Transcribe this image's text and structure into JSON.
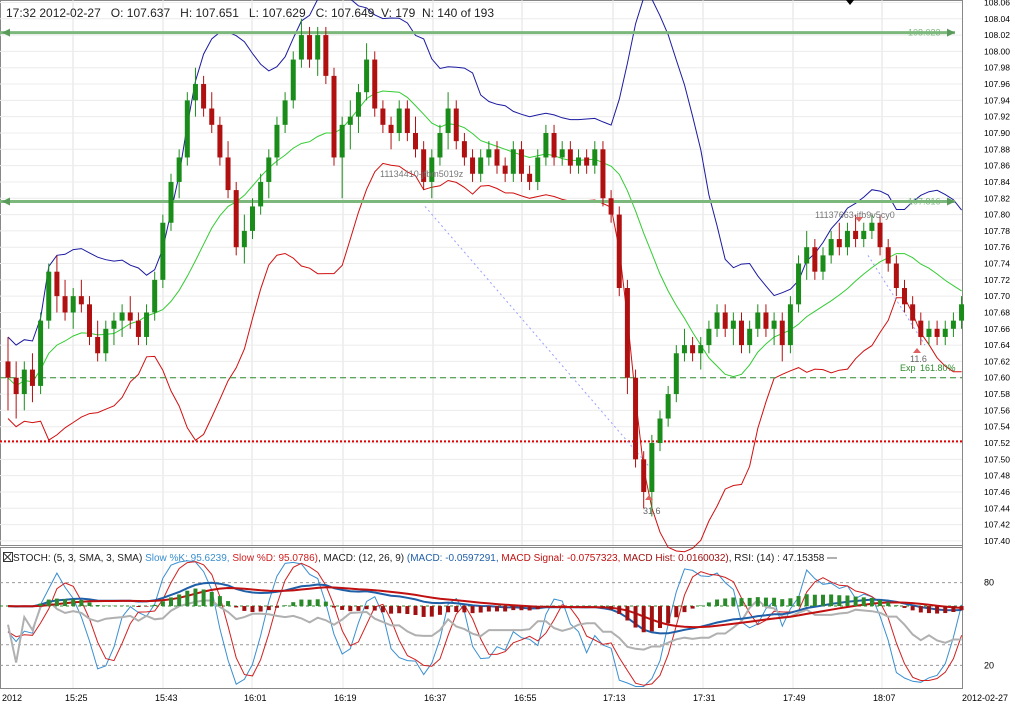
{
  "header": {
    "time": "17:32 2012-02-27",
    "open": "O: 107.637",
    "high": "H: 107.651",
    "low": "L: 107.629",
    "close": "C: 107.649",
    "volume": "V: 179",
    "bar_index": "N: 140 of 193"
  },
  "indicators": {
    "stoch_label": "STOCH: (5, 3, SMA, 3, SMA)",
    "slow_k": "Slow %K: 95.6239,",
    "slow_d": "Slow %D: 95.0786)",
    "macd_label": ", MACD: (12, 26, 9)",
    "macd": "(MACD: -0.0597291,",
    "macd_signal": "MACD Signal: -0.0757323,",
    "macd_hist": "MACD Hist: 0.0160032)",
    "rsi": ", RSI: (14) : 47.15358",
    "colors": {
      "k": "#3a8fd0",
      "d": "#d02020",
      "macd": "#1f5fa8",
      "signal": "#c01010",
      "hist_pos": "#2a8a2a",
      "hist_neg": "#a01010",
      "rsi": "#b0b0b0"
    }
  },
  "price_axis": {
    "labels": [
      "108.06",
      "108.04",
      "108.02",
      "108.00",
      "107.98",
      "107.96",
      "107.94",
      "107.92",
      "107.90",
      "107.88",
      "107.86",
      "107.84",
      "107.82",
      "107.80",
      "107.78",
      "107.76",
      "107.74",
      "107.72",
      "107.70",
      "107.68",
      "107.66",
      "107.64",
      "107.62",
      "107.60",
      "107.58",
      "107.56",
      "107.54",
      "107.52",
      "107.50",
      "107.48",
      "107.46",
      "107.44",
      "107.42",
      "107.40"
    ],
    "ylim": [
      107.395,
      108.063
    ]
  },
  "time_axis": {
    "labels": [
      "2012",
      "15:25",
      "15:43",
      "16:01",
      "16:19",
      "16:37",
      "16:55",
      "17:13",
      "17:31",
      "17:49",
      "18:07",
      "2012-02-27"
    ]
  },
  "osc_axis": {
    "labels": [
      "80",
      "20"
    ]
  },
  "annotations": {
    "level_high": "108.023",
    "level_low": "107.816",
    "text_left": "11134410-jfbm5019z",
    "text_right": "11137663-jfb9v5cy0",
    "label_31": "31.6",
    "label_11": "11.6",
    "exp_label": "Exp",
    "exp_value": "161.80%"
  },
  "chart_data": {
    "type": "candlestick",
    "symbol_date": "2012-02-27",
    "price_range": [
      107.4,
      108.06
    ],
    "horizontal_levels": {
      "resistance": 108.023,
      "support": 107.816,
      "green_dashed": 107.6,
      "red_dotted": 107.522
    },
    "candles_ohlc": [
      [
        107.62,
        107.65,
        107.56,
        107.6
      ],
      [
        107.6,
        107.62,
        107.55,
        107.58
      ],
      [
        107.58,
        107.62,
        107.56,
        107.61
      ],
      [
        107.61,
        107.63,
        107.57,
        107.59
      ],
      [
        107.59,
        107.68,
        107.58,
        107.67
      ],
      [
        107.67,
        107.74,
        107.66,
        107.73
      ],
      [
        107.73,
        107.75,
        107.68,
        107.7
      ],
      [
        107.7,
        107.72,
        107.67,
        107.68
      ],
      [
        107.68,
        107.71,
        107.66,
        107.7
      ],
      [
        107.7,
        107.72,
        107.68,
        107.69
      ],
      [
        107.69,
        107.7,
        107.64,
        107.65
      ],
      [
        107.65,
        107.67,
        107.62,
        107.63
      ],
      [
        107.63,
        107.67,
        107.62,
        107.66
      ],
      [
        107.66,
        107.68,
        107.64,
        107.67
      ],
      [
        107.67,
        107.69,
        107.65,
        107.68
      ],
      [
        107.68,
        107.7,
        107.66,
        107.67
      ],
      [
        107.67,
        107.68,
        107.64,
        107.65
      ],
      [
        107.65,
        107.69,
        107.64,
        107.68
      ],
      [
        107.68,
        107.73,
        107.67,
        107.72
      ],
      [
        107.72,
        107.8,
        107.71,
        107.79
      ],
      [
        107.79,
        107.85,
        107.78,
        107.84
      ],
      [
        107.84,
        107.88,
        107.82,
        107.87
      ],
      [
        107.87,
        107.95,
        107.86,
        107.94
      ],
      [
        107.94,
        107.98,
        107.92,
        107.96
      ],
      [
        107.96,
        107.97,
        107.92,
        107.93
      ],
      [
        107.93,
        107.95,
        107.9,
        107.91
      ],
      [
        107.91,
        107.92,
        107.86,
        107.87
      ],
      [
        107.87,
        107.89,
        107.82,
        107.83
      ],
      [
        107.83,
        107.84,
        107.75,
        107.76
      ],
      [
        107.76,
        107.8,
        107.74,
        107.78
      ],
      [
        107.78,
        107.82,
        107.77,
        107.81
      ],
      [
        107.81,
        107.85,
        107.8,
        107.84
      ],
      [
        107.84,
        107.88,
        107.82,
        107.87
      ],
      [
        107.87,
        107.92,
        107.86,
        107.91
      ],
      [
        107.91,
        107.95,
        107.9,
        107.94
      ],
      [
        107.94,
        108.0,
        107.93,
        107.99
      ],
      [
        107.99,
        108.04,
        107.98,
        108.02
      ],
      [
        108.02,
        108.03,
        107.98,
        107.99
      ],
      [
        107.99,
        108.03,
        107.97,
        108.02
      ],
      [
        108.02,
        108.03,
        107.96,
        107.97
      ],
      [
        107.97,
        107.98,
        107.86,
        107.87
      ],
      [
        107.87,
        107.92,
        107.82,
        107.91
      ],
      [
        107.91,
        107.94,
        107.88,
        107.92
      ],
      [
        107.92,
        107.96,
        107.9,
        107.95
      ],
      [
        107.95,
        108.01,
        107.94,
        107.99
      ],
      [
        107.99,
        108.0,
        107.92,
        107.93
      ],
      [
        107.93,
        107.94,
        107.9,
        107.91
      ],
      [
        107.91,
        107.92,
        107.88,
        107.9
      ],
      [
        107.9,
        107.94,
        107.89,
        107.93
      ],
      [
        107.93,
        107.94,
        107.89,
        107.9
      ],
      [
        107.9,
        107.92,
        107.87,
        107.88
      ],
      [
        107.88,
        107.89,
        107.83,
        107.84
      ],
      [
        107.84,
        107.88,
        107.82,
        107.87
      ],
      [
        107.87,
        107.91,
        107.86,
        107.9
      ],
      [
        107.9,
        107.95,
        107.88,
        107.93
      ],
      [
        107.93,
        107.94,
        107.88,
        107.89
      ],
      [
        107.89,
        107.9,
        107.86,
        107.87
      ],
      [
        107.87,
        107.88,
        107.84,
        107.85
      ],
      [
        107.85,
        107.88,
        107.84,
        107.87
      ],
      [
        107.87,
        107.89,
        107.86,
        107.88
      ],
      [
        107.88,
        107.89,
        107.85,
        107.86
      ],
      [
        107.86,
        107.87,
        107.84,
        107.85
      ],
      [
        107.85,
        107.89,
        107.84,
        107.88
      ],
      [
        107.88,
        107.89,
        107.84,
        107.85
      ],
      [
        107.85,
        107.86,
        107.83,
        107.84
      ],
      [
        107.84,
        107.88,
        107.83,
        107.87
      ],
      [
        107.87,
        107.91,
        107.86,
        107.9
      ],
      [
        107.9,
        107.91,
        107.86,
        107.87
      ],
      [
        107.87,
        107.89,
        107.86,
        107.88
      ],
      [
        107.88,
        107.89,
        107.85,
        107.86
      ],
      [
        107.86,
        107.88,
        107.85,
        107.87
      ],
      [
        107.87,
        107.88,
        107.85,
        107.86
      ],
      [
        107.86,
        107.89,
        107.85,
        107.88
      ],
      [
        107.88,
        107.89,
        107.81,
        107.82
      ],
      [
        107.82,
        107.83,
        107.79,
        107.8
      ],
      [
        107.8,
        107.81,
        107.7,
        107.71
      ],
      [
        107.71,
        107.72,
        107.58,
        107.6
      ],
      [
        107.6,
        107.61,
        107.49,
        107.5
      ],
      [
        107.5,
        107.51,
        107.44,
        107.46
      ],
      [
        107.46,
        107.53,
        107.43,
        107.52
      ],
      [
        107.52,
        107.56,
        107.51,
        107.55
      ],
      [
        107.55,
        107.59,
        107.54,
        107.58
      ],
      [
        107.58,
        107.64,
        107.57,
        107.63
      ],
      [
        107.63,
        107.66,
        107.62,
        107.64
      ],
      [
        107.64,
        107.65,
        107.62,
        107.63
      ],
      [
        107.63,
        107.65,
        107.61,
        107.64
      ],
      [
        107.64,
        107.67,
        107.63,
        107.66
      ],
      [
        107.66,
        107.69,
        107.65,
        107.68
      ],
      [
        107.68,
        107.69,
        107.65,
        107.66
      ],
      [
        107.66,
        107.68,
        107.64,
        107.67
      ],
      [
        107.67,
        107.68,
        107.63,
        107.64
      ],
      [
        107.64,
        107.67,
        107.63,
        107.66
      ],
      [
        107.66,
        107.69,
        107.65,
        107.68
      ],
      [
        107.68,
        107.69,
        107.65,
        107.66
      ],
      [
        107.66,
        107.68,
        107.64,
        107.67
      ],
      [
        107.67,
        107.68,
        107.62,
        107.64
      ],
      [
        107.64,
        107.7,
        107.63,
        107.69
      ],
      [
        107.69,
        107.75,
        107.68,
        107.74
      ],
      [
        107.74,
        107.78,
        107.72,
        107.76
      ],
      [
        107.76,
        107.77,
        107.72,
        107.73
      ],
      [
        107.73,
        107.76,
        107.72,
        107.75
      ],
      [
        107.75,
        107.78,
        107.74,
        107.77
      ],
      [
        107.77,
        107.79,
        107.75,
        107.76
      ],
      [
        107.76,
        107.79,
        107.75,
        107.78
      ],
      [
        107.78,
        107.8,
        107.76,
        107.77
      ],
      [
        107.77,
        107.79,
        107.76,
        107.78
      ],
      [
        107.78,
        107.8,
        107.77,
        107.79
      ],
      [
        107.79,
        107.8,
        107.75,
        107.76
      ],
      [
        107.76,
        107.77,
        107.73,
        107.74
      ],
      [
        107.74,
        107.75,
        107.7,
        107.71
      ],
      [
        107.71,
        107.72,
        107.68,
        107.69
      ],
      [
        107.69,
        107.7,
        107.66,
        107.67
      ],
      [
        107.67,
        107.68,
        107.64,
        107.65
      ],
      [
        107.65,
        107.67,
        107.64,
        107.66
      ],
      [
        107.66,
        107.67,
        107.64,
        107.65
      ],
      [
        107.65,
        107.67,
        107.64,
        107.66
      ],
      [
        107.66,
        107.68,
        107.65,
        107.67
      ],
      [
        107.67,
        107.7,
        107.66,
        107.69
      ]
    ],
    "indicators": [
      "Bollinger Bands (blue/red)",
      "Moving Average (green)",
      "STOCH (5,3,SMA,3,SMA)",
      "MACD (12,26,9)",
      "RSI (14)"
    ],
    "stoch_levels": [
      80,
      20
    ]
  }
}
